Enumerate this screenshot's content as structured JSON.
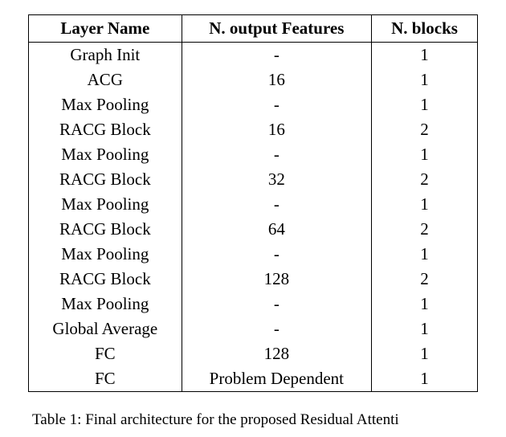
{
  "chart_data": {
    "type": "table",
    "columns": [
      "Layer Name",
      "N. output Features",
      "N. blocks"
    ],
    "rows": [
      {
        "layer": "Graph Init",
        "features": "-",
        "blocks": "1"
      },
      {
        "layer": "ACG",
        "features": "16",
        "blocks": "1"
      },
      {
        "layer": "Max Pooling",
        "features": "-",
        "blocks": "1"
      },
      {
        "layer": "RACG Block",
        "features": "16",
        "blocks": "2"
      },
      {
        "layer": "Max Pooling",
        "features": "-",
        "blocks": "1"
      },
      {
        "layer": "RACG Block",
        "features": "32",
        "blocks": "2"
      },
      {
        "layer": "Max Pooling",
        "features": "-",
        "blocks": "1"
      },
      {
        "layer": "RACG Block",
        "features": "64",
        "blocks": "2"
      },
      {
        "layer": "Max Pooling",
        "features": "-",
        "blocks": "1"
      },
      {
        "layer": "RACG Block",
        "features": "128",
        "blocks": "2"
      },
      {
        "layer": "Max Pooling",
        "features": "-",
        "blocks": "1"
      },
      {
        "layer": "Global Average",
        "features": "-",
        "blocks": "1"
      },
      {
        "layer": "FC",
        "features": "128",
        "blocks": "1"
      },
      {
        "layer": "FC",
        "features": "Problem Dependent",
        "blocks": "1"
      }
    ]
  },
  "caption_prefix": "Table 1: Final architecture for the proposed Residual Attenti"
}
